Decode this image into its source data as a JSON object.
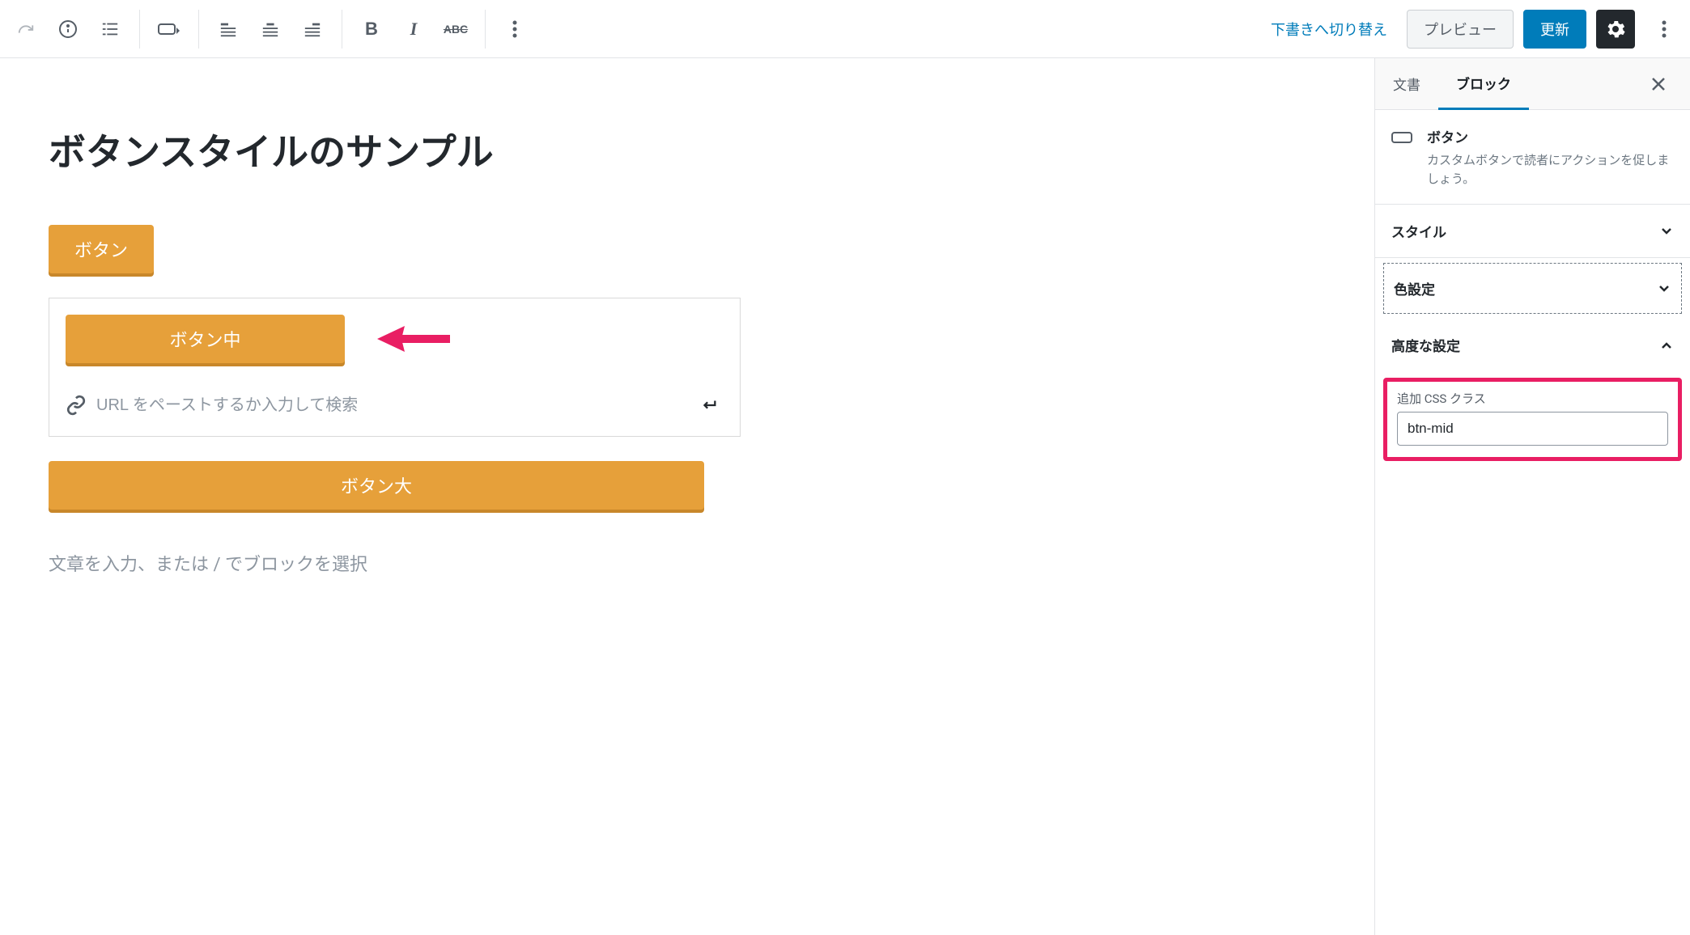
{
  "header": {
    "switch_draft": "下書きへ切り替え",
    "preview": "プレビュー",
    "update": "更新"
  },
  "editor": {
    "title": "ボタンスタイルのサンプル",
    "button_small": "ボタン",
    "button_mid": "ボタン中",
    "button_large": "ボタン大",
    "url_placeholder": "URL をペーストするか入力して検索",
    "placeholder_text": "文章を入力、または / でブロックを選択"
  },
  "sidebar": {
    "tabs": {
      "document": "文書",
      "block": "ブロック"
    },
    "block_info": {
      "title": "ボタン",
      "desc": "カスタムボタンで読者にアクションを促しましょう。"
    },
    "panels": {
      "style": "スタイル",
      "color": "色設定",
      "advanced": "高度な設定"
    },
    "css": {
      "label": "追加 CSS クラス",
      "value": "btn-mid"
    }
  }
}
